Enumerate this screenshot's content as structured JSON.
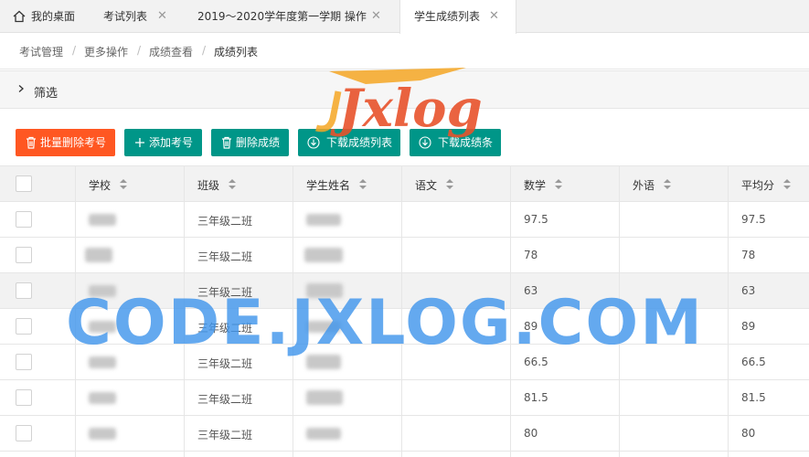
{
  "tabs": [
    {
      "label": "我的桌面"
    },
    {
      "label": "考试列表"
    },
    {
      "label": "2019～2020学年度第一学期 操作"
    },
    {
      "label": "学生成绩列表"
    }
  ],
  "breadcrumb": [
    "考试管理",
    "更多操作",
    "成绩查看",
    "成绩列表"
  ],
  "filter": {
    "label": "筛选"
  },
  "toolbar": {
    "batch_delete": "批量删除考号",
    "add_exam_no": "添加考号",
    "delete_scores": "删除成绩",
    "download_list": "下载成绩列表",
    "download_slips": "下载成绩条"
  },
  "columns": [
    "学校",
    "班级",
    "学生姓名",
    "语文",
    "数学",
    "外语",
    "平均分"
  ],
  "rows": [
    {
      "class": "三年级二班",
      "chinese": "",
      "math": "97.5",
      "english": "",
      "average": "97.5"
    },
    {
      "class": "三年级二班",
      "chinese": "",
      "math": "78",
      "english": "",
      "average": "78"
    },
    {
      "class": "三年级二班",
      "chinese": "",
      "math": "63",
      "english": "",
      "average": "63"
    },
    {
      "class": "三年级二班",
      "chinese": "",
      "math": "89",
      "english": "",
      "average": "89"
    },
    {
      "class": "三年级二班",
      "chinese": "",
      "math": "66.5",
      "english": "",
      "average": "66.5"
    },
    {
      "class": "三年级二班",
      "chinese": "",
      "math": "81.5",
      "english": "",
      "average": "81.5"
    },
    {
      "class": "三年级二班",
      "chinese": "",
      "math": "80",
      "english": "",
      "average": "80"
    }
  ],
  "watermark": {
    "logo_text": "Jxlog",
    "domain_text": "CODE.JXLOG.COM"
  },
  "colors": {
    "orange": "#ff5722",
    "teal": "#009688",
    "watermark_blue": "#4296eb",
    "logo_orange": "#f5a623"
  }
}
